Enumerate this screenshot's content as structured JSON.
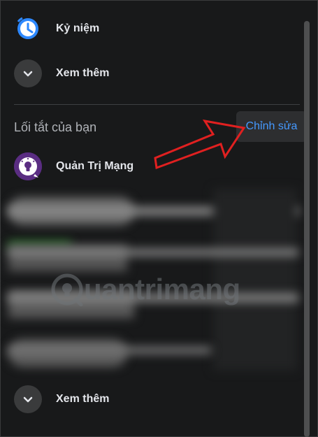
{
  "top": {
    "memories_label": "Kỷ niệm",
    "see_more_label": "Xem thêm"
  },
  "shortcuts": {
    "title": "Lối tắt của bạn",
    "edit_label": "Chỉnh sửa",
    "items": [
      {
        "label": "Quản Trị Mạng"
      }
    ],
    "see_more_label": "Xem thêm"
  },
  "watermark": {
    "text": "uantrimang"
  },
  "colors": {
    "background": "#18191a",
    "accent_link": "#4599ff",
    "annotation_arrow": "#e02020"
  }
}
